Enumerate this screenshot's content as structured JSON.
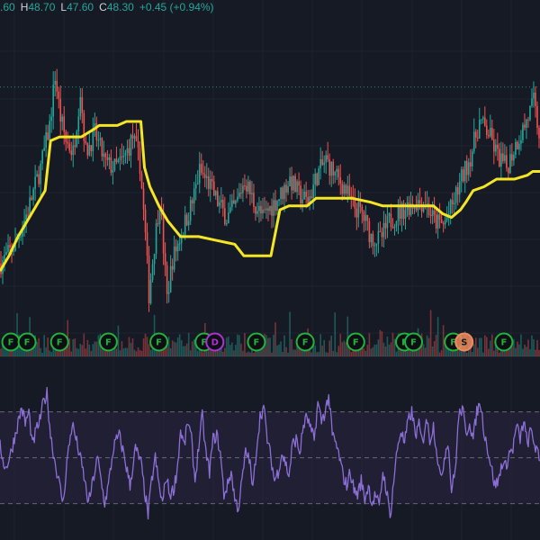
{
  "header": {
    "ohlc": [
      {
        "key": "",
        "value": ".60"
      },
      {
        "key": "H",
        "value": "48.70"
      },
      {
        "key": "L",
        "value": "47.60"
      },
      {
        "key": "C",
        "value": "48.30"
      },
      {
        "key": "",
        "value": "+0.45 (+0.94%)"
      }
    ]
  },
  "colors": {
    "background": "#161a25",
    "grid": "#1f2330",
    "up": "#26a69a",
    "down": "#ef5350",
    "overlay_line": "#f5e625",
    "rsi_line": "#8c6fd6",
    "rsi_band": "#2a2340",
    "event_green": "#22b33a",
    "event_purple": "#b02fd6",
    "event_orange": "#f08a5d"
  },
  "chart_data": [
    {
      "type": "candlestick",
      "title": "",
      "last": {
        "open": 47.85,
        "high": 48.7,
        "low": 47.6,
        "close": 48.3,
        "change": 0.45,
        "change_pct": 0.94
      },
      "price_range": [
        43.0,
        51.8
      ],
      "price_line": 50.0,
      "x_range": [
        0,
        299
      ],
      "close_path": [
        [
          0,
          45.4
        ],
        [
          8,
          45.9
        ],
        [
          15,
          46.8
        ],
        [
          22,
          47.9
        ],
        [
          27,
          49.0
        ],
        [
          30,
          50.3
        ],
        [
          33,
          49.2
        ],
        [
          36,
          48.6
        ],
        [
          40,
          48.3
        ],
        [
          44,
          49.9
        ],
        [
          47,
          48.3
        ],
        [
          52,
          48.8
        ],
        [
          58,
          48.0
        ],
        [
          63,
          47.9
        ],
        [
          68,
          48.1
        ],
        [
          73,
          48.7
        ],
        [
          77,
          48.0
        ],
        [
          80,
          46.1
        ],
        [
          82,
          44.6
        ],
        [
          85,
          45.9
        ],
        [
          88,
          47.1
        ],
        [
          92,
          44.5
        ],
        [
          95,
          45.5
        ],
        [
          100,
          46.2
        ],
        [
          106,
          47.0
        ],
        [
          110,
          47.8
        ],
        [
          115,
          47.5
        ],
        [
          120,
          47.0
        ],
        [
          125,
          46.6
        ],
        [
          130,
          46.9
        ],
        [
          135,
          47.6
        ],
        [
          140,
          47.0
        ],
        [
          145,
          46.6
        ],
        [
          150,
          46.9
        ],
        [
          155,
          47.2
        ],
        [
          160,
          47.6
        ],
        [
          165,
          47.2
        ],
        [
          170,
          47.0
        ],
        [
          175,
          47.7
        ],
        [
          180,
          48.1
        ],
        [
          185,
          47.7
        ],
        [
          190,
          47.4
        ],
        [
          195,
          46.9
        ],
        [
          200,
          46.7
        ],
        [
          205,
          46.1
        ],
        [
          210,
          46.0
        ],
        [
          215,
          46.5
        ],
        [
          220,
          46.7
        ],
        [
          225,
          46.9
        ],
        [
          230,
          47.0
        ],
        [
          235,
          47.0
        ],
        [
          240,
          46.5
        ],
        [
          245,
          46.4
        ],
        [
          250,
          46.9
        ],
        [
          255,
          47.6
        ],
        [
          260,
          48.2
        ],
        [
          265,
          49.1
        ],
        [
          270,
          48.8
        ],
        [
          275,
          48.2
        ],
        [
          280,
          47.9
        ],
        [
          285,
          48.5
        ],
        [
          290,
          49.0
        ],
        [
          295,
          49.6
        ],
        [
          299,
          48.5
        ]
      ],
      "volume_scale": "relative"
    },
    {
      "type": "line",
      "name": "overlay",
      "x_y": [
        [
          0,
          45.2
        ],
        [
          5,
          45.6
        ],
        [
          10,
          46.1
        ],
        [
          15,
          46.5
        ],
        [
          20,
          46.9
        ],
        [
          25,
          47.3
        ],
        [
          28,
          48.6
        ],
        [
          33,
          48.7
        ],
        [
          45,
          48.7
        ],
        [
          52,
          48.9
        ],
        [
          55,
          49.0
        ],
        [
          65,
          49.0
        ],
        [
          70,
          49.1
        ],
        [
          78,
          49.1
        ],
        [
          80,
          47.9
        ],
        [
          83,
          47.4
        ],
        [
          88,
          46.9
        ],
        [
          93,
          46.5
        ],
        [
          100,
          46.1
        ],
        [
          110,
          46.1
        ],
        [
          120,
          46.0
        ],
        [
          130,
          45.9
        ],
        [
          135,
          45.6
        ],
        [
          140,
          45.6
        ],
        [
          148,
          45.6
        ],
        [
          150,
          45.6
        ],
        [
          155,
          46.8
        ],
        [
          160,
          46.9
        ],
        [
          170,
          46.9
        ],
        [
          175,
          47.1
        ],
        [
          185,
          47.1
        ],
        [
          195,
          47.1
        ],
        [
          205,
          47.0
        ],
        [
          212,
          46.9
        ],
        [
          225,
          46.9
        ],
        [
          235,
          46.9
        ],
        [
          240,
          46.9
        ],
        [
          245,
          46.7
        ],
        [
          250,
          46.6
        ],
        [
          255,
          46.8
        ],
        [
          258,
          47.0
        ],
        [
          262,
          47.3
        ],
        [
          268,
          47.4
        ],
        [
          275,
          47.6
        ],
        [
          285,
          47.6
        ],
        [
          292,
          47.7
        ],
        [
          295,
          47.8
        ],
        [
          299,
          47.8
        ]
      ]
    },
    {
      "type": "event_markers",
      "markers": [
        {
          "x": 6,
          "label": "F",
          "kind": "F"
        },
        {
          "x": 15,
          "label": "F",
          "kind": "F"
        },
        {
          "x": 33,
          "label": "F",
          "kind": "F"
        },
        {
          "x": 60,
          "label": "F",
          "kind": "F"
        },
        {
          "x": 88,
          "label": "F",
          "kind": "F"
        },
        {
          "x": 113,
          "label": "F",
          "kind": "F"
        },
        {
          "x": 119,
          "label": "D",
          "kind": "D"
        },
        {
          "x": 142,
          "label": "F",
          "kind": "F"
        },
        {
          "x": 169,
          "label": "F",
          "kind": "F"
        },
        {
          "x": 197,
          "label": "F",
          "kind": "F"
        },
        {
          "x": 224,
          "label": "F",
          "kind": "F"
        },
        {
          "x": 229,
          "label": "F",
          "kind": "F"
        },
        {
          "x": 251,
          "label": "F",
          "kind": "F"
        },
        {
          "x": 257,
          "label": "S",
          "kind": "S"
        },
        {
          "x": 279,
          "label": "F",
          "kind": "F"
        }
      ]
    },
    {
      "type": "line",
      "name": "oscillator",
      "y_range": [
        22,
        84
      ],
      "levels": [
        70,
        50,
        30
      ],
      "x_y": [
        [
          0,
          55
        ],
        [
          3,
          45
        ],
        [
          6,
          52
        ],
        [
          9,
          62
        ],
        [
          12,
          72
        ],
        [
          14,
          65
        ],
        [
          16,
          70
        ],
        [
          18,
          55
        ],
        [
          20,
          62
        ],
        [
          22,
          66
        ],
        [
          24,
          74
        ],
        [
          26,
          78
        ],
        [
          28,
          60
        ],
        [
          30,
          50
        ],
        [
          32,
          42
        ],
        [
          35,
          30
        ],
        [
          37,
          48
        ],
        [
          40,
          65
        ],
        [
          43,
          55
        ],
        [
          46,
          44
        ],
        [
          49,
          30
        ],
        [
          52,
          42
        ],
        [
          54,
          50
        ],
        [
          56,
          40
        ],
        [
          58,
          30
        ],
        [
          60,
          38
        ],
        [
          63,
          55
        ],
        [
          66,
          60
        ],
        [
          69,
          50
        ],
        [
          72,
          38
        ],
        [
          75,
          54
        ],
        [
          78,
          48
        ],
        [
          80,
          36
        ],
        [
          82,
          25
        ],
        [
          84,
          40
        ],
        [
          86,
          50
        ],
        [
          88,
          38
        ],
        [
          90,
          30
        ],
        [
          92,
          42
        ],
        [
          94,
          34
        ],
        [
          96,
          36
        ],
        [
          98,
          44
        ],
        [
          100,
          62
        ],
        [
          102,
          55
        ],
        [
          104,
          66
        ],
        [
          106,
          58
        ],
        [
          108,
          40
        ],
        [
          110,
          55
        ],
        [
          112,
          68
        ],
        [
          114,
          52
        ],
        [
          116,
          44
        ],
        [
          118,
          58
        ],
        [
          120,
          60
        ],
        [
          122,
          52
        ],
        [
          124,
          34
        ],
        [
          126,
          38
        ],
        [
          128,
          44
        ],
        [
          130,
          32
        ],
        [
          132,
          28
        ],
        [
          134,
          40
        ],
        [
          136,
          52
        ],
        [
          138,
          50
        ],
        [
          140,
          36
        ],
        [
          142,
          54
        ],
        [
          144,
          68
        ],
        [
          146,
          72
        ],
        [
          148,
          58
        ],
        [
          150,
          50
        ],
        [
          152,
          40
        ],
        [
          154,
          44
        ],
        [
          156,
          52
        ],
        [
          158,
          48
        ],
        [
          160,
          42
        ],
        [
          162,
          56
        ],
        [
          164,
          58
        ],
        [
          166,
          52
        ],
        [
          168,
          64
        ],
        [
          170,
          68
        ],
        [
          172,
          62
        ],
        [
          174,
          58
        ],
        [
          176,
          74
        ],
        [
          178,
          66
        ],
        [
          180,
          70
        ],
        [
          182,
          77
        ],
        [
          184,
          60
        ],
        [
          186,
          56
        ],
        [
          188,
          50
        ],
        [
          190,
          42
        ],
        [
          192,
          38
        ],
        [
          194,
          44
        ],
        [
          196,
          36
        ],
        [
          198,
          34
        ],
        [
          200,
          40
        ],
        [
          202,
          32
        ],
        [
          204,
          38
        ],
        [
          206,
          30
        ],
        [
          208,
          34
        ],
        [
          210,
          28
        ],
        [
          212,
          44
        ],
        [
          214,
          36
        ],
        [
          216,
          24
        ],
        [
          218,
          40
        ],
        [
          220,
          54
        ],
        [
          222,
          62
        ],
        [
          224,
          56
        ],
        [
          226,
          66
        ],
        [
          228,
          70
        ],
        [
          230,
          60
        ],
        [
          232,
          64
        ],
        [
          234,
          56
        ],
        [
          236,
          68
        ],
        [
          238,
          58
        ],
        [
          240,
          64
        ],
        [
          242,
          52
        ],
        [
          244,
          40
        ],
        [
          246,
          50
        ],
        [
          248,
          58
        ],
        [
          250,
          36
        ],
        [
          252,
          44
        ],
        [
          254,
          68
        ],
        [
          256,
          72
        ],
        [
          258,
          60
        ],
        [
          260,
          66
        ],
        [
          262,
          58
        ],
        [
          264,
          70
        ],
        [
          266,
          74
        ],
        [
          268,
          62
        ],
        [
          270,
          54
        ],
        [
          272,
          46
        ],
        [
          274,
          38
        ],
        [
          276,
          40
        ],
        [
          278,
          48
        ],
        [
          280,
          46
        ],
        [
          282,
          52
        ],
        [
          284,
          54
        ],
        [
          286,
          64
        ],
        [
          288,
          58
        ],
        [
          290,
          66
        ],
        [
          292,
          56
        ],
        [
          294,
          62
        ],
        [
          296,
          56
        ],
        [
          299,
          48
        ]
      ]
    }
  ]
}
